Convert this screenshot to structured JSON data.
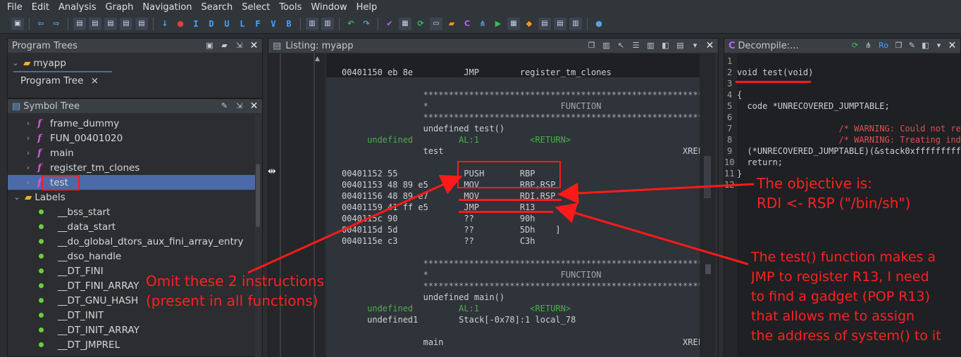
{
  "menu": [
    "File",
    "Edit",
    "Analysis",
    "Graph",
    "Navigation",
    "Search",
    "Select",
    "Tools",
    "Window",
    "Help"
  ],
  "toolbar": {
    "nav_letters": [
      "I",
      "D",
      "U",
      "L",
      "F",
      "V",
      "B"
    ]
  },
  "program_trees": {
    "title": "Program Trees",
    "root": "myapp",
    "tab": "Program Tree",
    "tab_close": "×"
  },
  "symbol_tree": {
    "title": "Symbol Tree",
    "functions": [
      "frame_dummy",
      "FUN_00401020",
      "main",
      "register_tm_clones",
      "test"
    ],
    "labels_title": "Labels",
    "labels": [
      "__bss_start",
      "__data_start",
      "__do_global_dtors_aux_fini_array_entry",
      "__dso_handle",
      "__DT_FINI",
      "__DT_FINI_ARRAY",
      "__DT_GNU_HASH",
      "__DT_INIT",
      "__DT_INIT_ARRAY",
      "__DT_JMPREL"
    ]
  },
  "listing": {
    "title": "Listing:  myapp",
    "rows": [
      "00401150 eb 8e          JMP        register_tm_clones",
      "                **************************************************************",
      "                *                          FUNCTION",
      "                **************************************************************",
      "                undefined test()",
      "     undefined         AL:1          <RETURN>",
      "                test                                               XREF",
      "00401152 55             PUSH       RBP",
      "00401153 48 89 e5       MOV        RBP,RSP",
      "00401156 48 89 e7       MOV        RDI,RSP",
      "00401159 41 ff e5       JMP        R13",
      "0040115c 90             ??         90h",
      "0040115d 5d             ??         5Dh    ]",
      "0040115e c3             ??         C3h",
      "                **************************************************************",
      "                *                          FUNCTION",
      "                **************************************************************",
      "                undefined main()",
      "     undefined         AL:1          <RETURN>",
      "     undefined1        Stack[-0x78]:1 local_78",
      "                main                                               XREF"
    ]
  },
  "decompile": {
    "title": "Decompile:...",
    "ro_label": "Ro",
    "line_numbers": [
      "1",
      "2",
      "3",
      "4",
      "5",
      "6",
      "7",
      "8",
      "9",
      "10",
      "11",
      "12"
    ],
    "lines": [
      "",
      "void test(void)",
      "",
      "{",
      "  code *UNRECOVERED_JUMPTABLE;",
      "",
      "                    /* WARNING: Could not re",
      "                    /* WARNING: Treating ind",
      "  (*UNRECOVERED_JUMPTABLE)(&stack0xfffffffff",
      "  return;",
      "}",
      ""
    ]
  },
  "annotations": {
    "omit": [
      "Omit these 2 instructions",
      "(present in all functions)"
    ],
    "objective": [
      "The objective is:",
      "RDI <- RSP (\"/bin/sh\")"
    ],
    "gadget": [
      "The test() function makes a",
      "JMP to register R13, I need",
      "to find a gadget (POP R13)",
      "that allows me to assign",
      "the address of system() to it"
    ]
  },
  "colors": {
    "annotation_red": "#ff1a1a",
    "selection_blue": "#4c6aa8",
    "listing_bg": "#1e2024"
  }
}
